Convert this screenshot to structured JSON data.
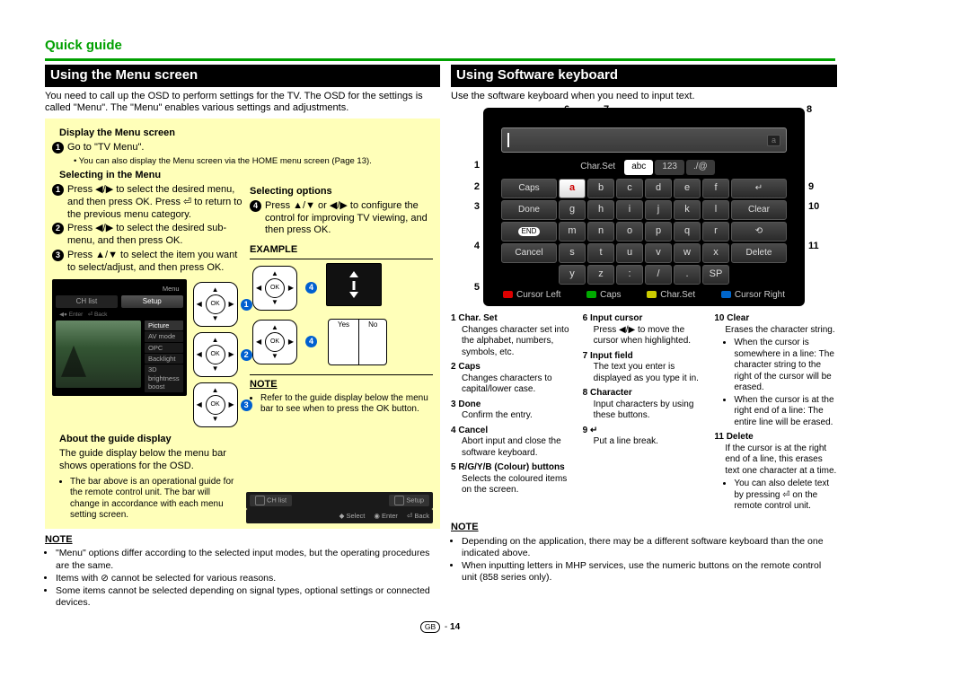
{
  "header": {
    "title": "Quick guide"
  },
  "left": {
    "section": "Using the Menu screen",
    "intro": "You need to call up the OSD to perform settings for the TV. The OSD for the settings is called \"Menu\". The \"Menu\" enables various settings and adjustments.",
    "display_head": "Display the Menu screen",
    "display_step1": "Go to \"TV Menu\".",
    "display_bullet": "You can also display the Menu screen via the HOME menu screen (Page 13).",
    "selecting_head": "Selecting in the Menu",
    "s1": "Press ◀/▶ to select the desired menu, and then press OK. Press ⏎ to return to the previous menu category.",
    "s2": "Press ◀/▶ to select the desired sub-menu, and then press OK.",
    "s3": "Press ▲/▼ to select the item you want to select/adjust, and then press OK.",
    "opt_head": "Selecting options",
    "s4": "Press ▲/▼ or ◀/▶ to configure the control for improving TV viewing, and then press OK.",
    "example_head": "EXAMPLE",
    "example_yes": "Yes",
    "example_no": "No",
    "note1_head": "NOTE",
    "note1_b1": "Refer to the guide display below the menu bar to see when to press the OK button.",
    "menu": {
      "title": "Menu",
      "tab1": "CH list",
      "tab2": "Setup",
      "items": [
        "Picture",
        "AV mode",
        "OPC",
        "Backlight",
        "3D brightness boost"
      ],
      "barSelect": "Select",
      "barEnter": "Enter",
      "barBack": "Back"
    },
    "about_head": "About the guide display",
    "about_text": "The guide display below the menu bar shows operations for the OSD.",
    "about_b1": "The bar above is an operational guide for the remote control unit. The bar will change in accordance with each menu setting screen.",
    "note_head": "NOTE",
    "nb1": "\"Menu\" options differ according to the selected input modes, but the operating procedures are the same.",
    "nb2": "Items with ⊘ cannot be selected for various reasons.",
    "nb3": "Some items cannot be selected depending on signal types, optional settings or connected devices."
  },
  "right": {
    "section": "Using Software keyboard",
    "intro": "Use the software keyboard when you need to input text.",
    "kbd": {
      "tab_charset": "Char.Set",
      "tab_abc": "abc",
      "tab_123": "123",
      "tab_sym": "./@",
      "caps": "Caps",
      "done": "Done",
      "end": "END",
      "cancel": "Cancel",
      "clear": "Clear",
      "delete": "Delete",
      "sp": "SP",
      "keys_r1": [
        "a",
        "b",
        "c",
        "d",
        "e",
        "f",
        "↵"
      ],
      "keys_r2": [
        "g",
        "h",
        "i",
        "j",
        "k",
        "l"
      ],
      "keys_r3": [
        "m",
        "n",
        "o",
        "p",
        "q",
        "r"
      ],
      "keys_r4": [
        "s",
        "t",
        "u",
        "v",
        "w",
        "x"
      ],
      "keys_r5": [
        "y",
        "z",
        ":",
        "/",
        "."
      ],
      "bottom_r": "Cursor Left",
      "bottom_g": "Caps",
      "bottom_y": "Char.Set",
      "bottom_b": "Cursor Right"
    },
    "callouts": [
      "1",
      "2",
      "3",
      "4",
      "5",
      "6",
      "7",
      "8",
      "9",
      "10",
      "11"
    ],
    "defs": [
      {
        "n": "1",
        "t": "Char. Set",
        "d": "Changes character set into the alphabet, numbers, symbols, etc."
      },
      {
        "n": "2",
        "t": "Caps",
        "d": "Changes characters to capital/lower case."
      },
      {
        "n": "3",
        "t": "Done",
        "d": "Confirm the entry."
      },
      {
        "n": "4",
        "t": "Cancel",
        "d": "Abort input and close the software keyboard."
      },
      {
        "n": "5",
        "t": "R/G/Y/B (Colour) buttons",
        "d": "Selects the coloured items on the screen."
      },
      {
        "n": "6",
        "t": "Input cursor",
        "d": "Press ◀/▶ to move the cursor when highlighted."
      },
      {
        "n": "7",
        "t": "Input field",
        "d": "The text you enter is displayed as you type it in."
      },
      {
        "n": "8",
        "t": "Character",
        "d": "Input characters by using these buttons."
      },
      {
        "n": "9",
        "t": "↵",
        "d": "Put a line break."
      },
      {
        "n": "10",
        "t": "Clear",
        "d": "Erases the character string.",
        "sub": [
          "When the cursor is somewhere in a line: The character string to the right of the cursor will be erased.",
          "When the cursor is at the right end of a line: The entire line will be erased."
        ]
      },
      {
        "n": "11",
        "t": "Delete",
        "d": "If the cursor is at the right end of a line, this erases text one character at a time.",
        "sub": [
          "You can also delete text by pressing ⏎ on the remote control unit."
        ]
      }
    ],
    "note_head": "NOTE",
    "nb1": "Depending on the application, there may be a different software keyboard than the one indicated above.",
    "nb2": "When inputting letters in MHP services, use the numeric buttons on the remote control unit (858 series only)."
  },
  "footer": {
    "gb": "GB",
    "page": "14"
  }
}
